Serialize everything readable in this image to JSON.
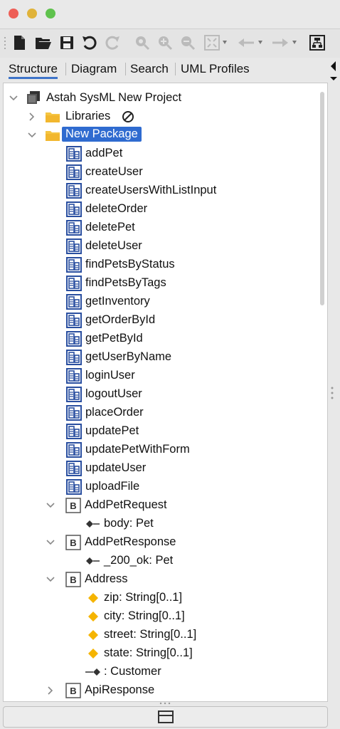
{
  "window": {
    "buttons": [
      "close",
      "minimize",
      "zoom"
    ]
  },
  "toolbar": {
    "icons": [
      "new-file-icon",
      "open-folder-icon",
      "save-icon",
      "undo-icon",
      "redo-icon",
      "zoom-fit-icon",
      "zoom-in-icon",
      "zoom-out-icon",
      "fit-window-icon",
      "back-icon",
      "forward-icon",
      "diagram-layout-icon"
    ]
  },
  "tabs": [
    {
      "label": "Structure",
      "active": true
    },
    {
      "label": "Diagram",
      "active": false
    },
    {
      "label": "Search",
      "active": false
    },
    {
      "label": "UML Profiles",
      "active": false
    }
  ],
  "tree": {
    "project": "Astah SysML New Project",
    "libraries": "Libraries",
    "package": "New Package",
    "operations": [
      "addPet",
      "createUser",
      "createUsersWithListInput",
      "deleteOrder",
      "deletePet",
      "deleteUser",
      "findPetsByStatus",
      "findPetsByTags",
      "getInventory",
      "getOrderById",
      "getPetById",
      "getUserByName",
      "loginUser",
      "logoutUser",
      "placeOrder",
      "updatePet",
      "updatePetWithForm",
      "updateUser",
      "uploadFile"
    ],
    "blocks": [
      {
        "name": "AddPetRequest",
        "expanded": true,
        "children": [
          {
            "type": "part",
            "label": "body: Pet"
          }
        ]
      },
      {
        "name": "AddPetResponse",
        "expanded": true,
        "children": [
          {
            "type": "part",
            "label": "_200_ok: Pet"
          }
        ]
      },
      {
        "name": "Address",
        "expanded": true,
        "children": [
          {
            "type": "value",
            "label": "zip: String[0..1]"
          },
          {
            "type": "value",
            "label": "city: String[0..1]"
          },
          {
            "type": "value",
            "label": "street: String[0..1]"
          },
          {
            "type": "value",
            "label": "state: String[0..1]"
          },
          {
            "type": "assoc",
            "label": ": Customer"
          }
        ]
      },
      {
        "name": "ApiResponse",
        "expanded": false,
        "children": []
      }
    ]
  },
  "colors": {
    "selection": "#2f6bd0",
    "tab_underline": "#3e74c9",
    "folder": "#f5c542",
    "value_property": "#f5b400"
  }
}
